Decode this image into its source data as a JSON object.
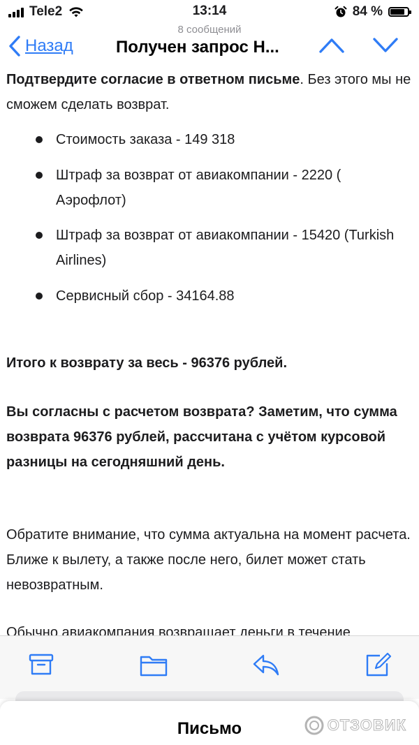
{
  "status_bar": {
    "carrier": "Tele2",
    "time": "13:14",
    "battery_percent": "84 %",
    "battery_level": 0.84
  },
  "nav": {
    "message_count": "8 сообщений",
    "back_label": "Назад",
    "title": "Получен запрос Н..."
  },
  "email": {
    "confirm_bold": "Подтвердите согласие в ответном письме",
    "confirm_rest": ". Без этого мы не сможем сделать возврат.",
    "bullets": [
      "Стоимость заказа - 149 318",
      "Штраф за возврат от авиакомпании - 2220 ( Аэрофлот)",
      "Штраф за возврат от авиакомпании - 15420 (Turkish Airlines)",
      "Сервисный сбор - 34164.88"
    ],
    "total": "Итого к возврату за весь - 96376 рублей.",
    "question": "Вы согласны с расчетом возврата? Заметим, что сумма возврата 96376 рублей, рассчитана с учётом курсовой разницы на сегодняшний день.",
    "note": "Обратите внимание, что сумма актуальна на момент расчета. Ближе к вылету, а также после него, билет может стать невозвратным.",
    "cutoff": "Обычно авиакомпания возвращает деньги в течение"
  },
  "sheet": {
    "label": "Письмо"
  },
  "watermark": {
    "text": "ОТЗОВИК"
  },
  "colors": {
    "accent": "#2f7cf6",
    "text": "#1c1c1e",
    "toolbar_bg": "#f7f7f7"
  }
}
